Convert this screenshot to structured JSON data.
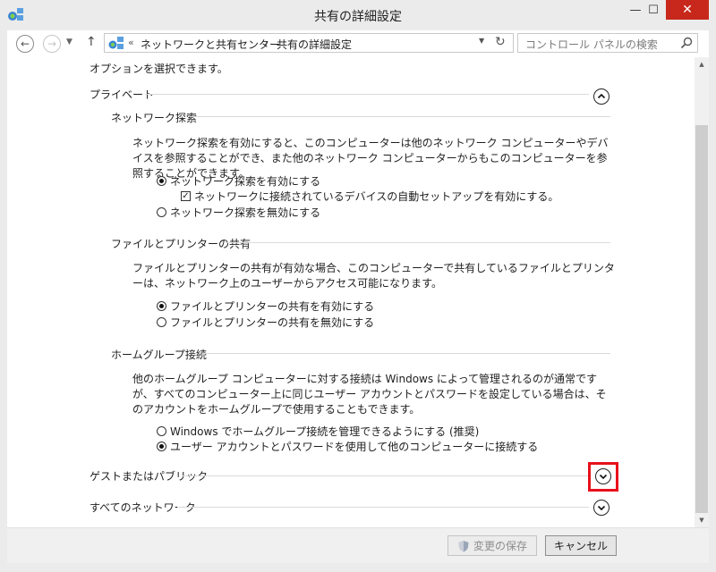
{
  "window": {
    "title": "共有の詳細設定",
    "minimize_glyph": "—",
    "maximize_glyph": "☐",
    "close_glyph": "✕"
  },
  "nav": {
    "back_glyph": "←",
    "forward_glyph": "→",
    "recent_glyph": "▼",
    "up_glyph": "↑",
    "breadcrumb": {
      "overflow": "«",
      "items": [
        "ネットワークと共有センター",
        "共有の詳細設定"
      ],
      "separator": "›"
    },
    "dropdown_glyph": "▼",
    "refresh_glyph": "↻",
    "search_placeholder": "コントロール パネルの検索"
  },
  "content": {
    "intro": "オプションを選択できます。",
    "private": {
      "title": "プライベート",
      "expanded": true,
      "network_discovery": {
        "title": "ネットワーク探索",
        "description": "ネットワーク探索を有効にすると、このコンピューターは他のネットワーク コンピューターやデバイスを参照することができ、また他のネットワーク コンピューターからもこのコンピューターを参照することができます。",
        "options": [
          {
            "label": "ネットワーク探索を有効にする",
            "selected": true
          },
          {
            "label": "ネットワーク探索を無効にする",
            "selected": false
          }
        ],
        "auto_setup": {
          "label": "ネットワークに接続されているデバイスの自動セットアップを有効にする。",
          "checked": true
        }
      },
      "file_printer_sharing": {
        "title": "ファイルとプリンターの共有",
        "description": "ファイルとプリンターの共有が有効な場合、このコンピューターで共有しているファイルとプリンターは、ネットワーク上のユーザーからアクセス可能になります。",
        "options": [
          {
            "label": "ファイルとプリンターの共有を有効にする",
            "selected": true
          },
          {
            "label": "ファイルとプリンターの共有を無効にする",
            "selected": false
          }
        ]
      },
      "homegroup": {
        "title": "ホームグループ接続",
        "description": "他のホームグループ コンピューターに対する接続は Windows によって管理されるのが通常ですが、すべてのコンピューター上に同じユーザー アカウントとパスワードを設定している場合は、そのアカウントをホームグループで使用することもできます。",
        "options": [
          {
            "label": "Windows でホームグループ接続を管理できるようにする (推奨)",
            "selected": false
          },
          {
            "label": "ユーザー アカウントとパスワードを使用して他のコンピューターに接続する",
            "selected": true
          }
        ]
      }
    },
    "guest_public": {
      "title": "ゲストまたはパブリック",
      "expanded": false
    },
    "all_networks": {
      "title": "すべてのネットワーク",
      "expanded": false
    }
  },
  "footer": {
    "save_label": "変更の保存",
    "cancel_label": "キャンセル"
  },
  "colors": {
    "close_button": "#c7281b",
    "highlight_box": "#e8101c"
  }
}
